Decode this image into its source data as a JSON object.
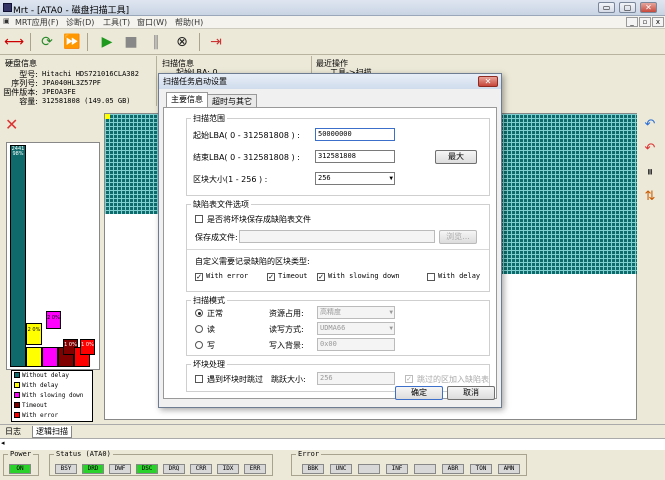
{
  "window": {
    "title": "Mrt - [ATA0 - 磁盘扫描工具]",
    "min": "▭",
    "max": "▢",
    "close": "✕"
  },
  "menu": [
    "MRT应用(F)",
    "诊断(D)",
    "工具(T)",
    "窗口(W)",
    "帮助(H)"
  ],
  "mdi_buttons": [
    "_",
    "▫",
    "x"
  ],
  "toolbar_icons": [
    "connect-icon",
    "refresh-icon",
    "fast-forward-icon",
    "play-icon",
    "stop-icon",
    "pause-icon",
    "cancel-icon",
    "exit-icon"
  ],
  "disk_info": {
    "title": "硬盘信息",
    "rows": [
      {
        "label": "型号:",
        "value": "Hitachi HDS721016CLA382"
      },
      {
        "label": "序列号:",
        "value": "JPA040HL3Z57PF"
      },
      {
        "label": "固件版本:",
        "value": "JPEOA3FE"
      },
      {
        "label": "容量:",
        "value": "312581808 (149.05 GB)"
      }
    ]
  },
  "scan_info": {
    "title": "扫描信息",
    "row1": "起始LBA: 0"
  },
  "recent_ops": {
    "title": "最近操作",
    "row1": "工具->扫描"
  },
  "left_panel": {
    "bar_label": "2441 98%",
    "block_2": "2 0%",
    "block_3": "2 0%",
    "block_4": "1 0%",
    "block_5": "1 0%",
    "legend": [
      {
        "label": "Without delay",
        "color": "#0f6b6b"
      },
      {
        "label": "With delay",
        "color": "#ffff00"
      },
      {
        "label": "With slowing down",
        "color": "#ff00ff"
      },
      {
        "label": "Timeout",
        "color": "#800000"
      },
      {
        "label": "With error",
        "color": "#ff0000"
      }
    ]
  },
  "tabs": [
    "日志",
    "逻辑扫描"
  ],
  "status": {
    "power": {
      "title": "Power",
      "items": [
        {
          "label": "ON",
          "on": true
        }
      ]
    },
    "status": {
      "title": "Status (ATA0)",
      "items": [
        {
          "label": "BSY",
          "on": false
        },
        {
          "label": "DRD",
          "on": true
        },
        {
          "label": "DWF",
          "on": false
        },
        {
          "label": "DSC",
          "on": true
        },
        {
          "label": "DRQ",
          "on": false
        },
        {
          "label": "CRR",
          "on": false
        },
        {
          "label": "IDX",
          "on": false
        },
        {
          "label": "ERR",
          "on": false
        }
      ]
    },
    "error": {
      "title": "Error",
      "items": [
        {
          "label": "BBK",
          "on": false
        },
        {
          "label": "UNC",
          "on": false
        },
        {
          "label": "",
          "on": false
        },
        {
          "label": "INF",
          "on": false
        },
        {
          "label": "",
          "on": false
        },
        {
          "label": "ABR",
          "on": false
        },
        {
          "label": "TON",
          "on": false
        },
        {
          "label": "AMN",
          "on": false
        }
      ]
    }
  },
  "dialog": {
    "title": "扫描任务启动设置",
    "tabs": [
      "主要信息",
      "超时与其它"
    ],
    "scan_range": {
      "title": "扫描范围",
      "start_label": "起始LBA( 0 - 312581808 ) :",
      "start_value": "50000000",
      "end_label": "结束LBA( 0 - 312581808 ) :",
      "end_value": "312581808",
      "max_button": "最大",
      "block_label": "区块大小(1 - 256 ) :",
      "block_value": "256"
    },
    "defect": {
      "title": "缺陷表文件选项",
      "save_check": "是否将坏块保存成缺陷表文件",
      "save_as_label": "保存成文件:",
      "browse": "浏览...",
      "record_label": "自定义需要记录缺陷的区块类型:",
      "types": [
        {
          "label": "With error",
          "checked": true
        },
        {
          "label": "Timeout",
          "checked": true
        },
        {
          "label": "With slowing down",
          "checked": true
        },
        {
          "label": "With delay",
          "checked": false
        }
      ]
    },
    "mode": {
      "title": "扫描模式",
      "options": [
        {
          "label": "正常",
          "on": true
        },
        {
          "label": "读",
          "on": false
        },
        {
          "label": "写",
          "on": false
        }
      ],
      "resource_label": "资源占用:",
      "resource_value": "高精度",
      "rw_label": "读写方式:",
      "rw_value": "UDMA66",
      "bg_label": "写入背景:",
      "bg_value": "0x00"
    },
    "badblock": {
      "title": "坏块处理",
      "skip_check": "遇到坏块时跳过",
      "jump_label": "跳跃大小:",
      "jump_value": "256",
      "add_check": "跳过的区加入缺陷表"
    },
    "ok": "确定",
    "cancel": "取消"
  }
}
